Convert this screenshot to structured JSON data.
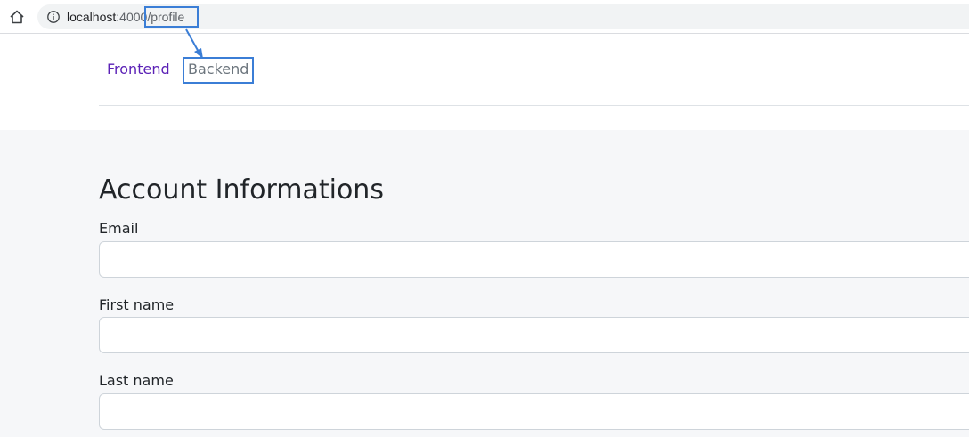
{
  "browser": {
    "url_host": "localhost",
    "url_port": ":4000",
    "url_path": "/profile"
  },
  "nav": {
    "items": [
      {
        "label": "Frontend",
        "color": "#5b21b6"
      },
      {
        "label": "Backend",
        "color": "#6c757d"
      }
    ]
  },
  "main": {
    "title": "Account Informations",
    "fields": [
      {
        "label": "Email",
        "value": ""
      },
      {
        "label": "First name",
        "value": ""
      },
      {
        "label": "Last name",
        "value": ""
      }
    ]
  },
  "annotation": {
    "color": "#3b7ed6"
  },
  "icons": [
    "home-icon",
    "info-icon",
    "annotation-arrow-icon"
  ]
}
